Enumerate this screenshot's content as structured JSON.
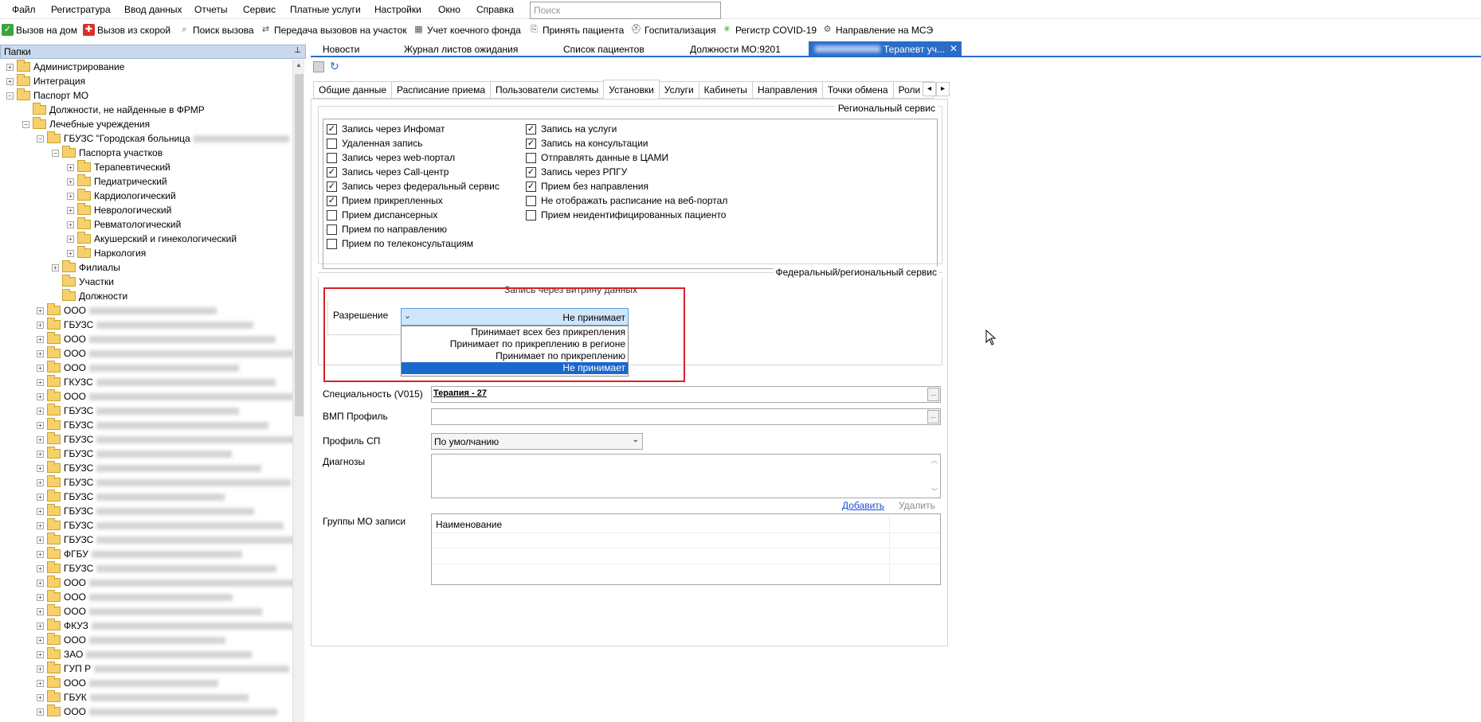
{
  "menu": [
    "Файл",
    "Регистратура",
    "Ввод данных",
    "Отчеты",
    "Сервис",
    "Платные услуги",
    "Настройки",
    "Окно",
    "Справка"
  ],
  "search": {
    "placeholder": "Поиск"
  },
  "toolbar": [
    "Вызов на дом",
    "Вызов из скорой",
    "Поиск вызова",
    "Передача вызовов на участок",
    "Учет коечного фонда",
    "Принять пациента",
    "Госпитализация",
    "Регистр COVID-19",
    "Направление на МСЭ"
  ],
  "folders_panel": {
    "title": "Папки"
  },
  "tree": {
    "top": [
      "Администрирование",
      "Интеграция",
      "Паспорт МО"
    ],
    "mo_children": [
      "Должности, не найденные в ФРМР",
      "Лечебные учреждения"
    ],
    "hospital": "ГБУЗС \"Городская больница",
    "passports": "Паспорта участков",
    "passport_items": [
      "Терапевтический",
      "Педиатрический",
      "Кардиологический",
      "Неврологический",
      "Ревматологический",
      "Акушерский и гинекологический",
      "Наркология"
    ],
    "after": [
      "Филиалы",
      "Участки",
      "Должности"
    ],
    "orgs": [
      "ООО",
      "ГБУЗС",
      "ООО",
      "ООО",
      "ООО",
      "ГКУЗС",
      "ООО",
      "ГБУЗС",
      "ГБУЗС",
      "ГБУЗС",
      "ГБУЗС",
      "ГБУЗС",
      "ГБУЗС",
      "ГБУЗС",
      "ГБУЗС",
      "ГБУЗС",
      "ГБУЗС",
      "ФГБУ",
      "ГБУЗС",
      "ООО",
      "ООО",
      "ООО",
      "ФКУЗ",
      "ООО",
      "ЗАО",
      "ГУП Р",
      "ООО",
      "ГБУК",
      "ООО"
    ]
  },
  "doc_tabs": [
    "Новости",
    "Журнал листов ожидания",
    "Список пациентов",
    "Должности МО:9201",
    "Терапевт уч..."
  ],
  "sub_tabs": [
    "Общие данные",
    "Расписание приема",
    "Пользователи системы",
    "Установки",
    "Услуги",
    "Кабинеты",
    "Направления",
    "Точки обмена",
    "Роли с"
  ],
  "regional": {
    "legend": "Региональный сервис",
    "left": [
      {
        "label": "Запись через Инфомат",
        "checked": true
      },
      {
        "label": "Удаленная запись",
        "checked": false
      },
      {
        "label": "Запись через web-портал",
        "checked": false
      },
      {
        "label": "Запись через Call-центр",
        "checked": true
      },
      {
        "label": "Запись через федеральный сервис",
        "checked": true
      },
      {
        "label": "Прием прикрепленных",
        "checked": true
      },
      {
        "label": "Прием диспансерных",
        "checked": false
      },
      {
        "label": "Прием по направлению",
        "checked": false
      },
      {
        "label": "Прием по телеконсультациям",
        "checked": false
      }
    ],
    "right": [
      {
        "label": "Запись на услуги",
        "checked": true
      },
      {
        "label": "Запись на консультации",
        "checked": true
      },
      {
        "label": "Отправлять данные в ЦАМИ",
        "checked": false
      },
      {
        "label": "Запись через РПГУ",
        "checked": true
      },
      {
        "label": "Прием без направления",
        "checked": true
      },
      {
        "label": "Не отображать расписание на веб-портал",
        "checked": false
      },
      {
        "label": "Прием неидентифицированных пациенто",
        "checked": false
      }
    ]
  },
  "federal": {
    "legend": "Федеральный/региональный сервис",
    "vitrina": "Запись через витрину данных",
    "permission_label": "Разрешение",
    "permission_value": "Не принимает",
    "options": [
      "Принимает всех без прикрепления",
      "Принимает по прикреплению в регионе",
      "Принимает по прикреплению",
      "Не принимает"
    ]
  },
  "form": {
    "specialty_label": "Специальность (V015)",
    "specialty_value": "Терапия - 27",
    "vmp_label": "ВМП Профиль",
    "sp_label": "Профиль СП",
    "sp_value": "По умолчанию",
    "diagnoses_label": "Диагнозы",
    "add_link": "Добавить",
    "delete_link": "Удалить",
    "groups_label": "Группы МО записи",
    "groups_header": "Наименование"
  },
  "colors": {
    "accent": "#2a6cc8",
    "highlight_box": "#d82028",
    "selected_option": "#1b68cc"
  }
}
